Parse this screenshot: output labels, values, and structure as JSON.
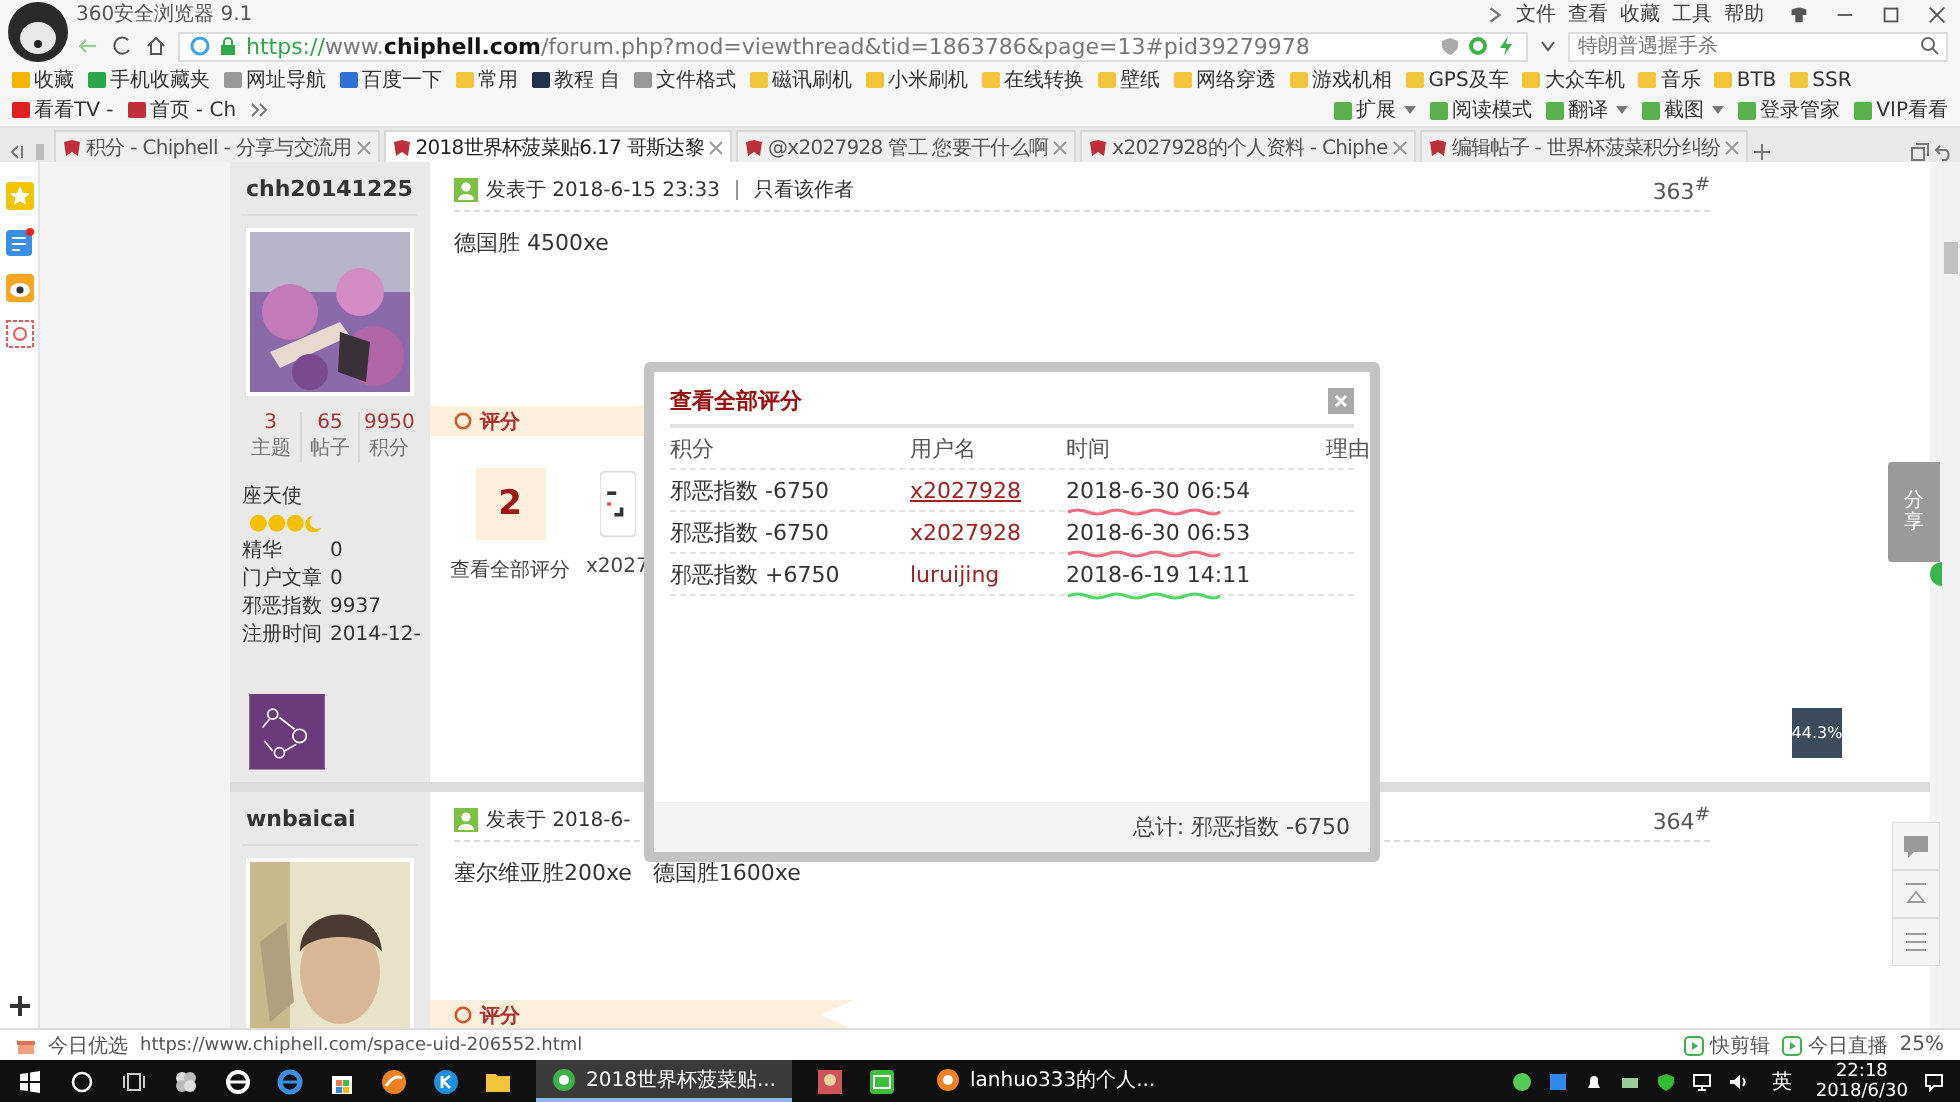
{
  "browser": {
    "title": "360安全浏览器 9.1",
    "menu": [
      "文件",
      "查看",
      "收藏",
      "工具",
      "帮助"
    ],
    "url": {
      "scheme": "https://",
      "host": "www.",
      "domain": "chiphell.com",
      "path": "/forum.php?mod=viewthread&tid=1863786&page=13#pid39279978"
    },
    "search": {
      "placeholder": "特朗普遇握手杀"
    }
  },
  "bookmarks": [
    {
      "label": "收藏",
      "kind": "star"
    },
    {
      "label": "手机收藏夹",
      "kind": "mobile"
    },
    {
      "label": "网址导航",
      "kind": "page"
    },
    {
      "label": "百度一下",
      "kind": "site"
    },
    {
      "label": "常用",
      "kind": "folder"
    },
    {
      "label": "教程 自",
      "kind": "dark"
    },
    {
      "label": "文件格式",
      "kind": "page"
    },
    {
      "label": "磁讯刷机",
      "kind": "folder"
    },
    {
      "label": "小米刷机",
      "kind": "folder"
    },
    {
      "label": "在线转换",
      "kind": "folder"
    },
    {
      "label": "壁纸",
      "kind": "folder"
    },
    {
      "label": "网络穿透",
      "kind": "folder"
    },
    {
      "label": "游戏机相",
      "kind": "folder"
    },
    {
      "label": "GPS及车",
      "kind": "folder"
    },
    {
      "label": "大众车机",
      "kind": "folder"
    },
    {
      "label": "音乐",
      "kind": "folder"
    },
    {
      "label": "BTB",
      "kind": "folder"
    },
    {
      "label": "SSR",
      "kind": "folder"
    },
    {
      "label": "看看TV -",
      "kind": "tv"
    },
    {
      "label": "首页 - Ch",
      "kind": "forum"
    }
  ],
  "toolbar": [
    {
      "label": "扩展",
      "dropdown": true
    },
    {
      "label": "阅读模式",
      "dropdown": false
    },
    {
      "label": "翻译",
      "dropdown": true
    },
    {
      "label": "截图",
      "dropdown": true
    },
    {
      "label": "登录管家",
      "dropdown": false
    },
    {
      "label": "VIP看看",
      "dropdown": false
    }
  ],
  "tabs": [
    {
      "label": "积分 - Chiphell - 分享与交流用",
      "selected": false
    },
    {
      "label": "2018世界杯菠菜贴6.17 哥斯达黎",
      "selected": true
    },
    {
      "label": "@x2027928 管工 您要干什么啊",
      "selected": false
    },
    {
      "label": "x2027928的个人资料 - Chiphe",
      "selected": false
    },
    {
      "label": "编辑帖子 - 世界杯菠菜积分纠纷",
      "selected": false
    }
  ],
  "posts": [
    {
      "author": "chh20141225",
      "stats": [
        {
          "value": "3",
          "label": "主题"
        },
        {
          "value": "65",
          "label": "帖子"
        },
        {
          "value": "9950",
          "label": "积分"
        }
      ],
      "group": "座天使",
      "fields": [
        {
          "label": "精华",
          "value": "0"
        },
        {
          "label": "门户文章",
          "value": "0"
        },
        {
          "label": "邪恶指数",
          "value": "9937"
        },
        {
          "label": "注册时间",
          "value": "2014-12-"
        }
      ],
      "posted": "发表于 2018-6-15 23:33",
      "only_author": "只看该作者",
      "floor": "363$^{#}$",
      "body": "德国胜 4500xe",
      "rating": {
        "label": "评分",
        "count": "2",
        "view_all": "查看全部评分",
        "rater": "x2027"
      }
    },
    {
      "author": "wnbaicai",
      "posted": "发表于 2018-6-",
      "floor": "364$^{#}$",
      "body": "塞尔维亚胜200xe   德国胜1600xe",
      "rating": {
        "label": "评分"
      }
    }
  ],
  "dialog": {
    "title": "查看全部评分",
    "columns": [
      "积分",
      "用户名",
      "时间",
      "理由"
    ],
    "rows": [
      {
        "points": "邪恶指数 -6750",
        "user": "x2027928",
        "hovered": true,
        "time": "2018-6-30 06:54",
        "color": "#f06a80"
      },
      {
        "points": "邪恶指数 -6750",
        "user": "x2027928",
        "hovered": false,
        "time": "2018-6-30 06:53",
        "color": "#f06a80"
      },
      {
        "points": "邪恶指数 +6750",
        "user": "luruijing",
        "hovered": false,
        "time": "2018-6-19 14:11",
        "color": "#4cd964"
      }
    ],
    "total": "总计: 邪恶指数 -6750"
  },
  "side": {
    "share": "分享",
    "percent": "44.3%"
  },
  "status_bar": {
    "label": "今日优选",
    "url": "https://www.chiphell.com/space-uid-206552.html",
    "items": [
      "快剪辑",
      "今日直播"
    ],
    "zoom": "25%"
  },
  "taskbar": {
    "windows": [
      {
        "label": "2018世界杯菠菜贴...",
        "selected": true
      },
      {
        "label": "lanhuo333的个人...",
        "selected": false
      }
    ],
    "ime": "英",
    "time": "22:18",
    "date": "2018/6/30"
  }
}
